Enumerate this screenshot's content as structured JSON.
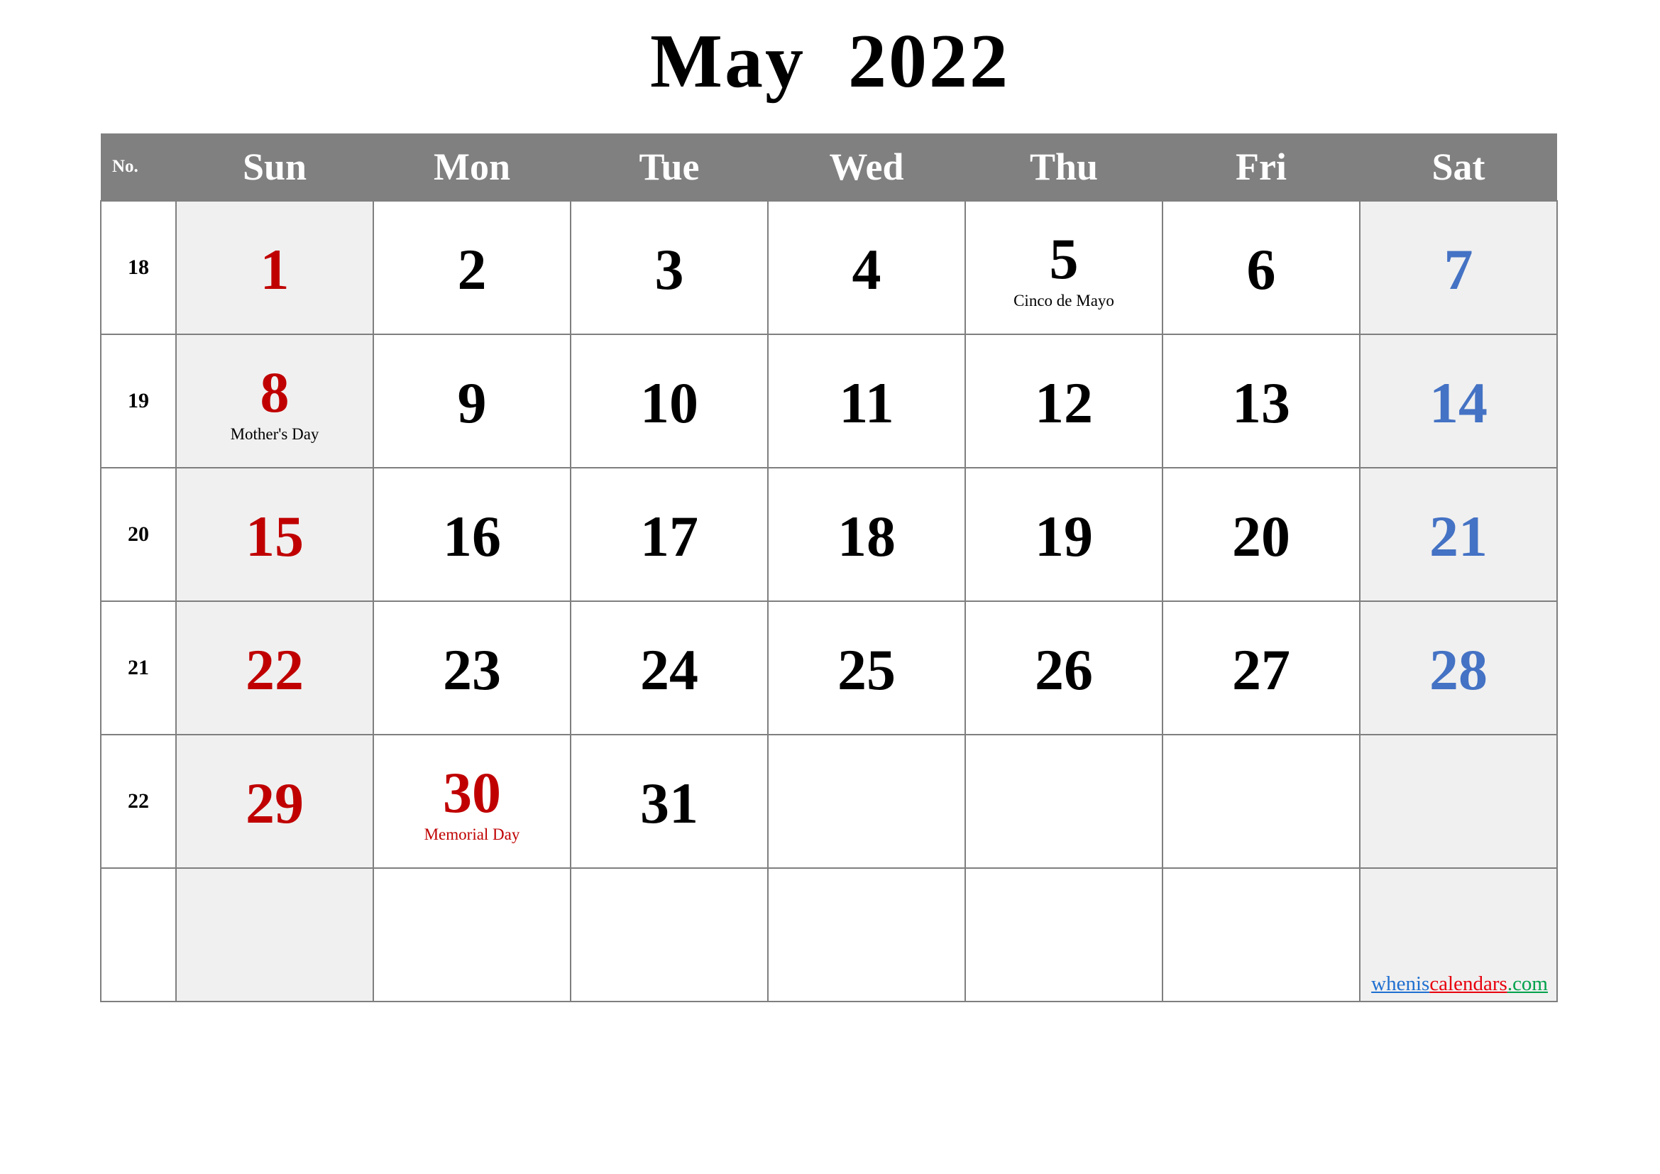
{
  "title": "May  2022",
  "month": "May",
  "year": "2022",
  "header": {
    "week_label": "No.",
    "days": [
      "Sun",
      "Mon",
      "Tue",
      "Wed",
      "Thu",
      "Fri",
      "Sat"
    ]
  },
  "colors": {
    "header_bg": "#808080",
    "header_text": "#ffffff",
    "grid_line": "#7f7f7f",
    "weekend_bg": "#f0f0f0",
    "sunday_text": "#c00000",
    "saturday_text": "#4472c4",
    "weekday_text": "#000000",
    "holiday_text": "#000000",
    "federal_holiday_text": "#c00000"
  },
  "watermark": {
    "part1": "whenis",
    "part2": "calendars",
    "part3": ".com",
    "part1_color": "#1f6fd0",
    "part2_color": "#e8000d",
    "part3_color": "#00a14b"
  },
  "weeks": [
    {
      "number": "18",
      "days": [
        {
          "date": "1",
          "holiday": "",
          "style": "red"
        },
        {
          "date": "2",
          "holiday": "",
          "style": "black"
        },
        {
          "date": "3",
          "holiday": "",
          "style": "black"
        },
        {
          "date": "4",
          "holiday": "",
          "style": "black"
        },
        {
          "date": "5",
          "holiday": "Cinco de Mayo",
          "style": "black",
          "holiday_style": "black"
        },
        {
          "date": "6",
          "holiday": "",
          "style": "black"
        },
        {
          "date": "7",
          "holiday": "",
          "style": "blue"
        }
      ]
    },
    {
      "number": "19",
      "days": [
        {
          "date": "8",
          "holiday": "Mother's Day",
          "style": "red",
          "holiday_style": "black"
        },
        {
          "date": "9",
          "holiday": "",
          "style": "black"
        },
        {
          "date": "10",
          "holiday": "",
          "style": "black"
        },
        {
          "date": "11",
          "holiday": "",
          "style": "black"
        },
        {
          "date": "12",
          "holiday": "",
          "style": "black"
        },
        {
          "date": "13",
          "holiday": "",
          "style": "black"
        },
        {
          "date": "14",
          "holiday": "",
          "style": "blue"
        }
      ]
    },
    {
      "number": "20",
      "days": [
        {
          "date": "15",
          "holiday": "",
          "style": "red"
        },
        {
          "date": "16",
          "holiday": "",
          "style": "black"
        },
        {
          "date": "17",
          "holiday": "",
          "style": "black"
        },
        {
          "date": "18",
          "holiday": "",
          "style": "black"
        },
        {
          "date": "19",
          "holiday": "",
          "style": "black"
        },
        {
          "date": "20",
          "holiday": "",
          "style": "black"
        },
        {
          "date": "21",
          "holiday": "",
          "style": "blue"
        }
      ]
    },
    {
      "number": "21",
      "days": [
        {
          "date": "22",
          "holiday": "",
          "style": "red"
        },
        {
          "date": "23",
          "holiday": "",
          "style": "black"
        },
        {
          "date": "24",
          "holiday": "",
          "style": "black"
        },
        {
          "date": "25",
          "holiday": "",
          "style": "black"
        },
        {
          "date": "26",
          "holiday": "",
          "style": "black"
        },
        {
          "date": "27",
          "holiday": "",
          "style": "black"
        },
        {
          "date": "28",
          "holiday": "",
          "style": "blue"
        }
      ]
    },
    {
      "number": "22",
      "days": [
        {
          "date": "29",
          "holiday": "",
          "style": "red"
        },
        {
          "date": "30",
          "holiday": "Memorial Day",
          "style": "red",
          "holiday_style": "red"
        },
        {
          "date": "31",
          "holiday": "",
          "style": "black"
        },
        {
          "date": "",
          "holiday": "",
          "style": "black"
        },
        {
          "date": "",
          "holiday": "",
          "style": "black"
        },
        {
          "date": "",
          "holiday": "",
          "style": "black"
        },
        {
          "date": "",
          "holiday": "",
          "style": "blue"
        }
      ]
    },
    {
      "number": "",
      "days": [
        {
          "date": "",
          "holiday": "",
          "style": "red"
        },
        {
          "date": "",
          "holiday": "",
          "style": "black"
        },
        {
          "date": "",
          "holiday": "",
          "style": "black"
        },
        {
          "date": "",
          "holiday": "",
          "style": "black"
        },
        {
          "date": "",
          "holiday": "",
          "style": "black"
        },
        {
          "date": "",
          "holiday": "",
          "style": "black"
        },
        {
          "date": "",
          "holiday": "",
          "style": "blue"
        }
      ]
    }
  ]
}
